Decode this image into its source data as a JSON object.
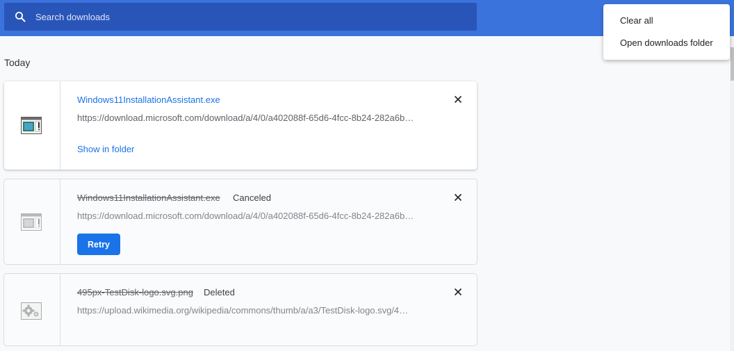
{
  "search": {
    "placeholder": "Search downloads",
    "icon": "search-icon"
  },
  "menu": {
    "items": [
      {
        "label": "Clear all"
      },
      {
        "label": "Open downloads folder"
      }
    ]
  },
  "section": {
    "heading": "Today"
  },
  "downloads": [
    {
      "file_name": "Windows11InstallationAssistant.exe",
      "url": "https://download.microsoft.com/download/a/4/0/a402088f-65d6-4fcc-8b24-282a6b…",
      "action_label": "Show in folder",
      "status": "",
      "icon": "exe-file-icon"
    },
    {
      "file_name": "Windows11InstallationAssistant.exe",
      "url": "https://download.microsoft.com/download/a/4/0/a402088f-65d6-4fcc-8b24-282a6b…",
      "action_label": "Retry",
      "status": "Canceled",
      "icon": "exe-file-icon"
    },
    {
      "file_name": "495px-TestDisk-logo.svg.png",
      "url": "https://upload.wikimedia.org/wikipedia/commons/thumb/a/a3/TestDisk-logo.svg/4…",
      "status": "Deleted",
      "icon": "image-file-icon"
    }
  ],
  "colors": {
    "toolbar": "#3b73dd",
    "search_box": "#2a55b8",
    "accent": "#1a73e8"
  }
}
